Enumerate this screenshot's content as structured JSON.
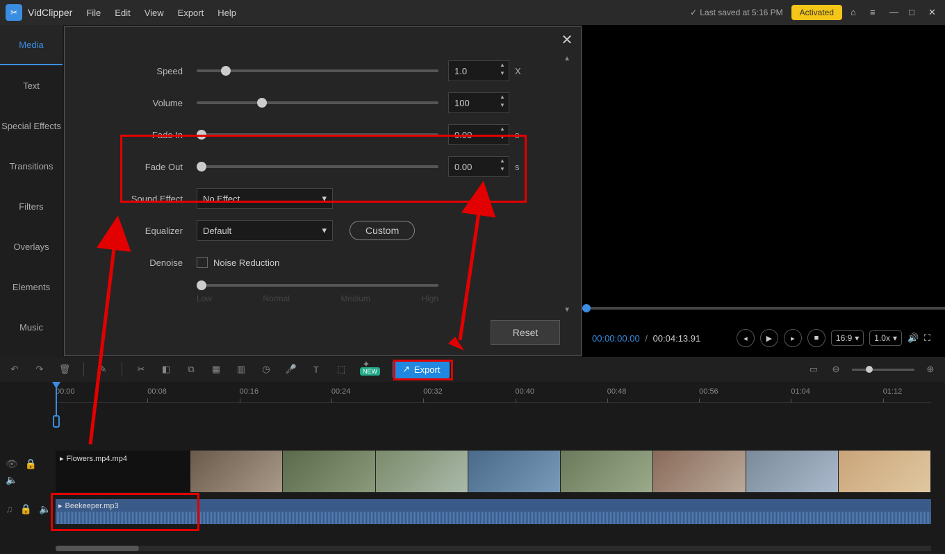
{
  "app": {
    "name": "VidClipper"
  },
  "menu": {
    "file": "File",
    "edit": "Edit",
    "view": "View",
    "export": "Export",
    "help": "Help"
  },
  "titlebar": {
    "save_status": "Last saved at 5:16 PM",
    "activated": "Activated"
  },
  "sidebar": {
    "items": [
      {
        "label": "Media"
      },
      {
        "label": "Text"
      },
      {
        "label": "Special Effects"
      },
      {
        "label": "Transitions"
      },
      {
        "label": "Filters"
      },
      {
        "label": "Overlays"
      },
      {
        "label": "Elements"
      },
      {
        "label": "Music"
      }
    ]
  },
  "modal": {
    "speed": {
      "label": "Speed",
      "value": "1.0",
      "unit": "X",
      "pos": 10
    },
    "volume": {
      "label": "Volume",
      "value": "100",
      "pos": 25
    },
    "fadein": {
      "label": "Fade In",
      "value": "0.00",
      "unit": "s",
      "pos": 0
    },
    "fadeout": {
      "label": "Fade Out",
      "value": "0.00",
      "unit": "s",
      "pos": 0
    },
    "sound_effect": {
      "label": "Sound Effect",
      "value": "No Effect"
    },
    "equalizer": {
      "label": "Equalizer",
      "value": "Default",
      "custom": "Custom"
    },
    "denoise": {
      "label": "Denoise",
      "checkbox_label": "Noise Reduction",
      "levels": [
        "Low",
        "Normal",
        "Medium",
        "High"
      ]
    },
    "reset": "Reset"
  },
  "preview": {
    "time_current": "00:00:00.00",
    "time_total": "00:04:13.91",
    "ratio": "16:9",
    "speed": "1.0x"
  },
  "toolbar": {
    "new_badge": "NEW",
    "export": "Export"
  },
  "timeline": {
    "ticks": [
      "00:00",
      "00:08",
      "00:16",
      "00:24",
      "00:32",
      "00:40",
      "00:48",
      "00:56",
      "01:04",
      "01:12"
    ],
    "video_clip": "Flowers.mp4.mp4",
    "audio_clip": "Beekeeper.mp3"
  }
}
